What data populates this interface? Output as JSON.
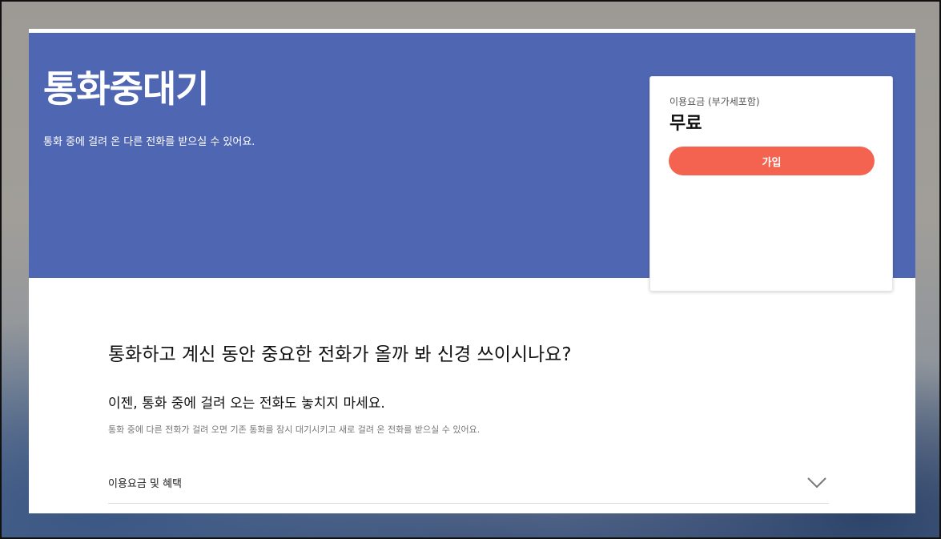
{
  "hero": {
    "title": "통화중대기",
    "description": "통화 중에 걸려 온 다른 전화를 받으실 수 있어요.",
    "background_color": "#4f67b3"
  },
  "pricing": {
    "label": "이용요금 (부가세포함)",
    "value": "무료",
    "join_label": "가입",
    "button_color": "#f4634f"
  },
  "main": {
    "headline": "통화하고 계신 동안 중요한 전화가 올까 봐 신경 쓰이시나요?",
    "subheadline": "이젠, 통화 중에 걸려 오는 전화도 놓치지 마세요.",
    "body": "통화 중에 다른 전화가 걸려 오면 기존 통화를 잠시 대기시키고 새로 걸려 온 전화를 받으실 수 있어요."
  },
  "accordion": {
    "label": "이용요금 및 혜택",
    "icon": "chevron-down-icon",
    "expanded": false
  }
}
